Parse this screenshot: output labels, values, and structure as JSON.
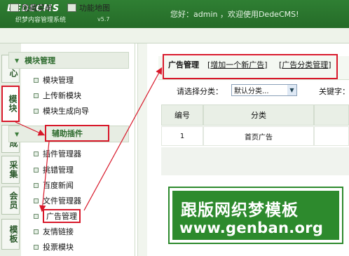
{
  "header": {
    "logo_main": "DEDECMS",
    "logo_sub": "织梦内容管理系统",
    "version": "v5.7",
    "greeting": "您好：admin ，欢迎使用DedeCMS!"
  },
  "toolbar": {
    "hide_menu": "隐藏菜单",
    "site_map": "功能地图"
  },
  "left_tabs": [
    "核心",
    "模块",
    "生成",
    "采集",
    "会员",
    "模板"
  ],
  "menu": {
    "module_section": "模块管理",
    "module_items": [
      "模块管理",
      "上传新模块",
      "模块生成向导"
    ],
    "plugin_section": "辅助插件",
    "plugin_items": [
      "插件管理器",
      "挑错管理",
      "百度新闻",
      "文件管理器",
      "广告管理",
      "友情链接",
      "投票模块"
    ]
  },
  "content": {
    "title": "广告管理",
    "link_add": "增加一个新广告",
    "link_category": "广告分类管理",
    "filter_label": "请选择分类：",
    "filter_value": "默认分类...",
    "keyword_label": "关键字：",
    "columns": [
      "编号",
      "分类"
    ],
    "rows": [
      [
        "1",
        "首页广告"
      ]
    ]
  },
  "watermark": {
    "line1": "跟版网织梦模板",
    "line2": "www.genban.org"
  },
  "colors": {
    "header_green": "#2f7f33",
    "highlight_red": "#d8182a",
    "watermark_green": "#2d8a2d"
  }
}
